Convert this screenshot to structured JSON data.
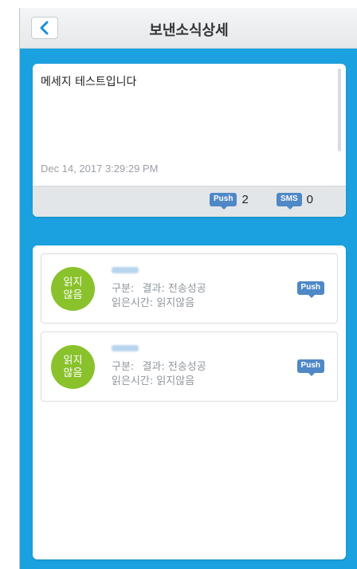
{
  "header": {
    "title": "보낸소식상세"
  },
  "message": {
    "body": "메세지 테스트입니다",
    "date": "Dec 14, 2017 3:29:29 PM",
    "push_label": "Push",
    "push_count": "2",
    "sms_label": "SMS",
    "sms_count": "0"
  },
  "recipients": [
    {
      "status_line1": "읽지",
      "status_line2": "않음",
      "category_label": "구분:",
      "result_text": "결과: 전송성공",
      "read_time_text": "읽은시간: 읽지않음",
      "channel": "Push"
    },
    {
      "status_line1": "읽지",
      "status_line2": "않음",
      "category_label": "구분:",
      "result_text": "결과: 전송성공",
      "read_time_text": "읽은시간: 읽지않음",
      "channel": "Push"
    }
  ],
  "colors": {
    "background": "#1ba1df",
    "status_unread": "#8ac22c",
    "badge": "#4f88c6"
  },
  "icons": {
    "back": "chevron-left-icon"
  }
}
